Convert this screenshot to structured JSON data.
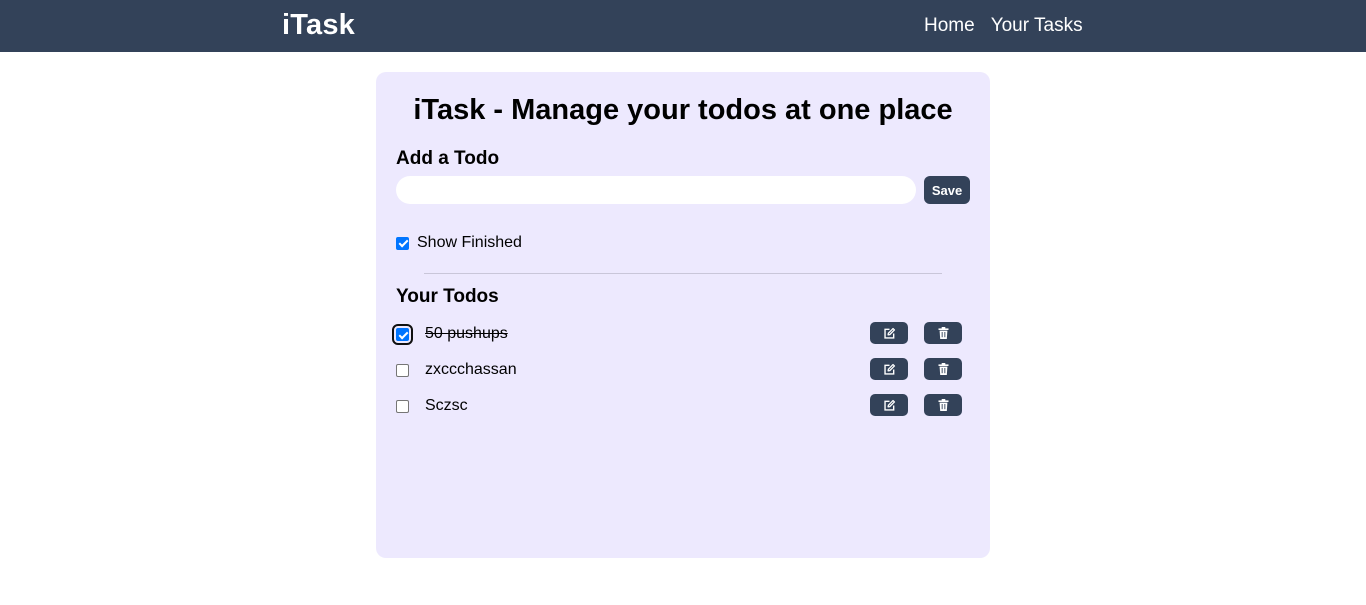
{
  "navbar": {
    "brand": "iTask",
    "links": [
      "Home",
      "Your Tasks"
    ]
  },
  "card": {
    "title": "iTask - Manage your todos at one place",
    "add_heading": "Add a Todo",
    "input": {
      "value": "",
      "placeholder": ""
    },
    "save_label": "Save",
    "show_finished": {
      "label": "Show Finished",
      "checked": true
    },
    "todos_heading": "Your Todos",
    "todos": [
      {
        "text": "50 pushups",
        "completed": true
      },
      {
        "text": "zxccchassan",
        "completed": false
      },
      {
        "text": "Sczsc",
        "completed": false
      }
    ],
    "icons": {
      "edit": "edit-icon",
      "delete": "trash-icon"
    }
  },
  "colors": {
    "navbar": "#334259",
    "card": "#ede9fe",
    "button": "#334259",
    "checkbox_checked": "#0075ff"
  }
}
